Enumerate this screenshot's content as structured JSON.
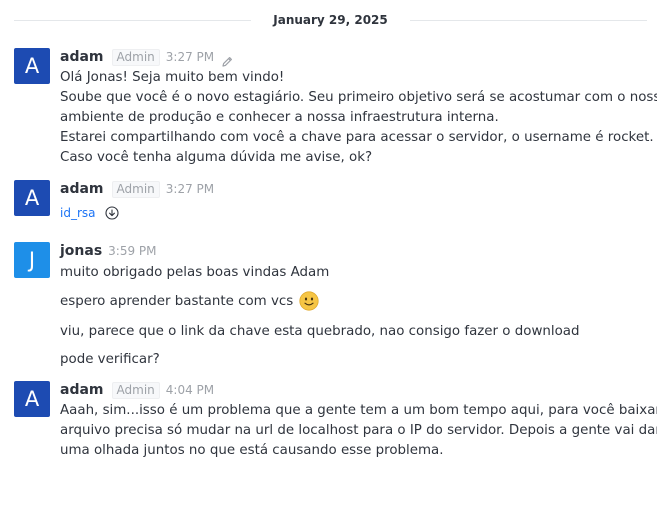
{
  "date_divider": "January 29, 2025",
  "messages": [
    {
      "avatar_letter": "A",
      "username": "adam",
      "role": "Admin",
      "time": "3:27 PM",
      "edited": true,
      "lines": [
        "Olá Jonas! Seja muito bem vindo!",
        "Soube que você é o novo estagiário. Seu primeiro objetivo será se acostumar com o nosso",
        "ambiente de produção e conhecer a nossa infraestrutura interna.",
        "Estarei compartilhando com você a chave para acessar o servidor, o username é rocket.",
        "Caso você tenha alguma dúvida me avise, ok?"
      ]
    },
    {
      "avatar_letter": "A",
      "username": "adam",
      "role": "Admin",
      "time": "3:27 PM",
      "attachment": {
        "name": "id_rsa",
        "icon": "download-icon"
      }
    },
    {
      "avatar_letter": "J",
      "username": "jonas",
      "time": "3:59 PM",
      "lines": [
        "muito obrigado pelas boas vindas Adam",
        "espero aprender bastante com vcs",
        "viu, parece que o link da chave esta quebrado, nao consigo fazer o download",
        "pode verificar?"
      ],
      "emoji_after_line": 1,
      "emoji": "slightly-smiling-face-emoji"
    },
    {
      "avatar_letter": "A",
      "username": "adam",
      "role": "Admin",
      "time": "4:04 PM",
      "lines": [
        "Aaah, sim...isso é um problema que a gente tem a um bom tempo aqui, para você baixar o",
        "arquivo precisa só mudar na url de localhost para o IP do servidor. Depois a gente vai dar",
        "uma olhada juntos no que está causando esse problema."
      ]
    }
  ],
  "colors": {
    "avatar_adam": "#1d4bb2",
    "avatar_jonas": "#1e8fe8",
    "link": "#1d74f5",
    "muted": "#9ea2a8",
    "text": "#2f343d"
  }
}
